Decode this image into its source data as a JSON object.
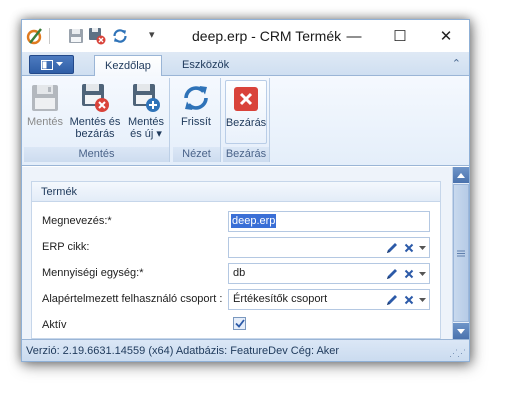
{
  "window": {
    "title": "deep.erp - CRM Termék",
    "minimize": "—",
    "maximize": "☐",
    "close": "✕"
  },
  "quick_access": {
    "dropdown": "▾"
  },
  "ribbon": {
    "tabs": [
      {
        "label": "Kezdőlap",
        "active": true
      },
      {
        "label": "Eszközök",
        "active": false
      }
    ],
    "collapse": "⌃",
    "groups": [
      {
        "label": "Mentés",
        "buttons": [
          {
            "label": "Mentés",
            "icon": "floppy-disk-icon",
            "enabled": false
          },
          {
            "label_line1": "Mentés és",
            "label_line2": "bezárás",
            "icon": "save-close-icon"
          },
          {
            "label_line1": "Mentés",
            "label_line2": "és új ▾",
            "icon": "save-new-icon"
          }
        ]
      },
      {
        "label": "Nézet",
        "buttons": [
          {
            "label": "Frissít",
            "icon": "refresh-icon"
          }
        ]
      },
      {
        "label": "Bezárás",
        "buttons": [
          {
            "label": "Bezárás",
            "icon": "close-red-icon"
          }
        ]
      }
    ]
  },
  "form": {
    "section_title": "Termék",
    "fields": [
      {
        "label": "Megnevezés:*",
        "value": "deep.erp",
        "type": "text",
        "selected": true
      },
      {
        "label": "ERP cikk:",
        "value": "",
        "type": "lookup"
      },
      {
        "label": "Mennyiségi egység:*",
        "value": "db",
        "type": "lookup"
      },
      {
        "label": "Alapértelmezett felhasználó csoport :",
        "value": "Értékesítők csoport",
        "type": "lookup"
      },
      {
        "label": "Aktív",
        "checked": true,
        "type": "checkbox"
      }
    ]
  },
  "status": {
    "text": "Verzió: 2.19.6631.14559 (x64)  Adatbázis: FeatureDev  Cég: Aker"
  },
  "colors": {
    "accent": "#2f5ea6",
    "close_red": "#d9433a",
    "pencil_blue": "#2c5aa8"
  }
}
